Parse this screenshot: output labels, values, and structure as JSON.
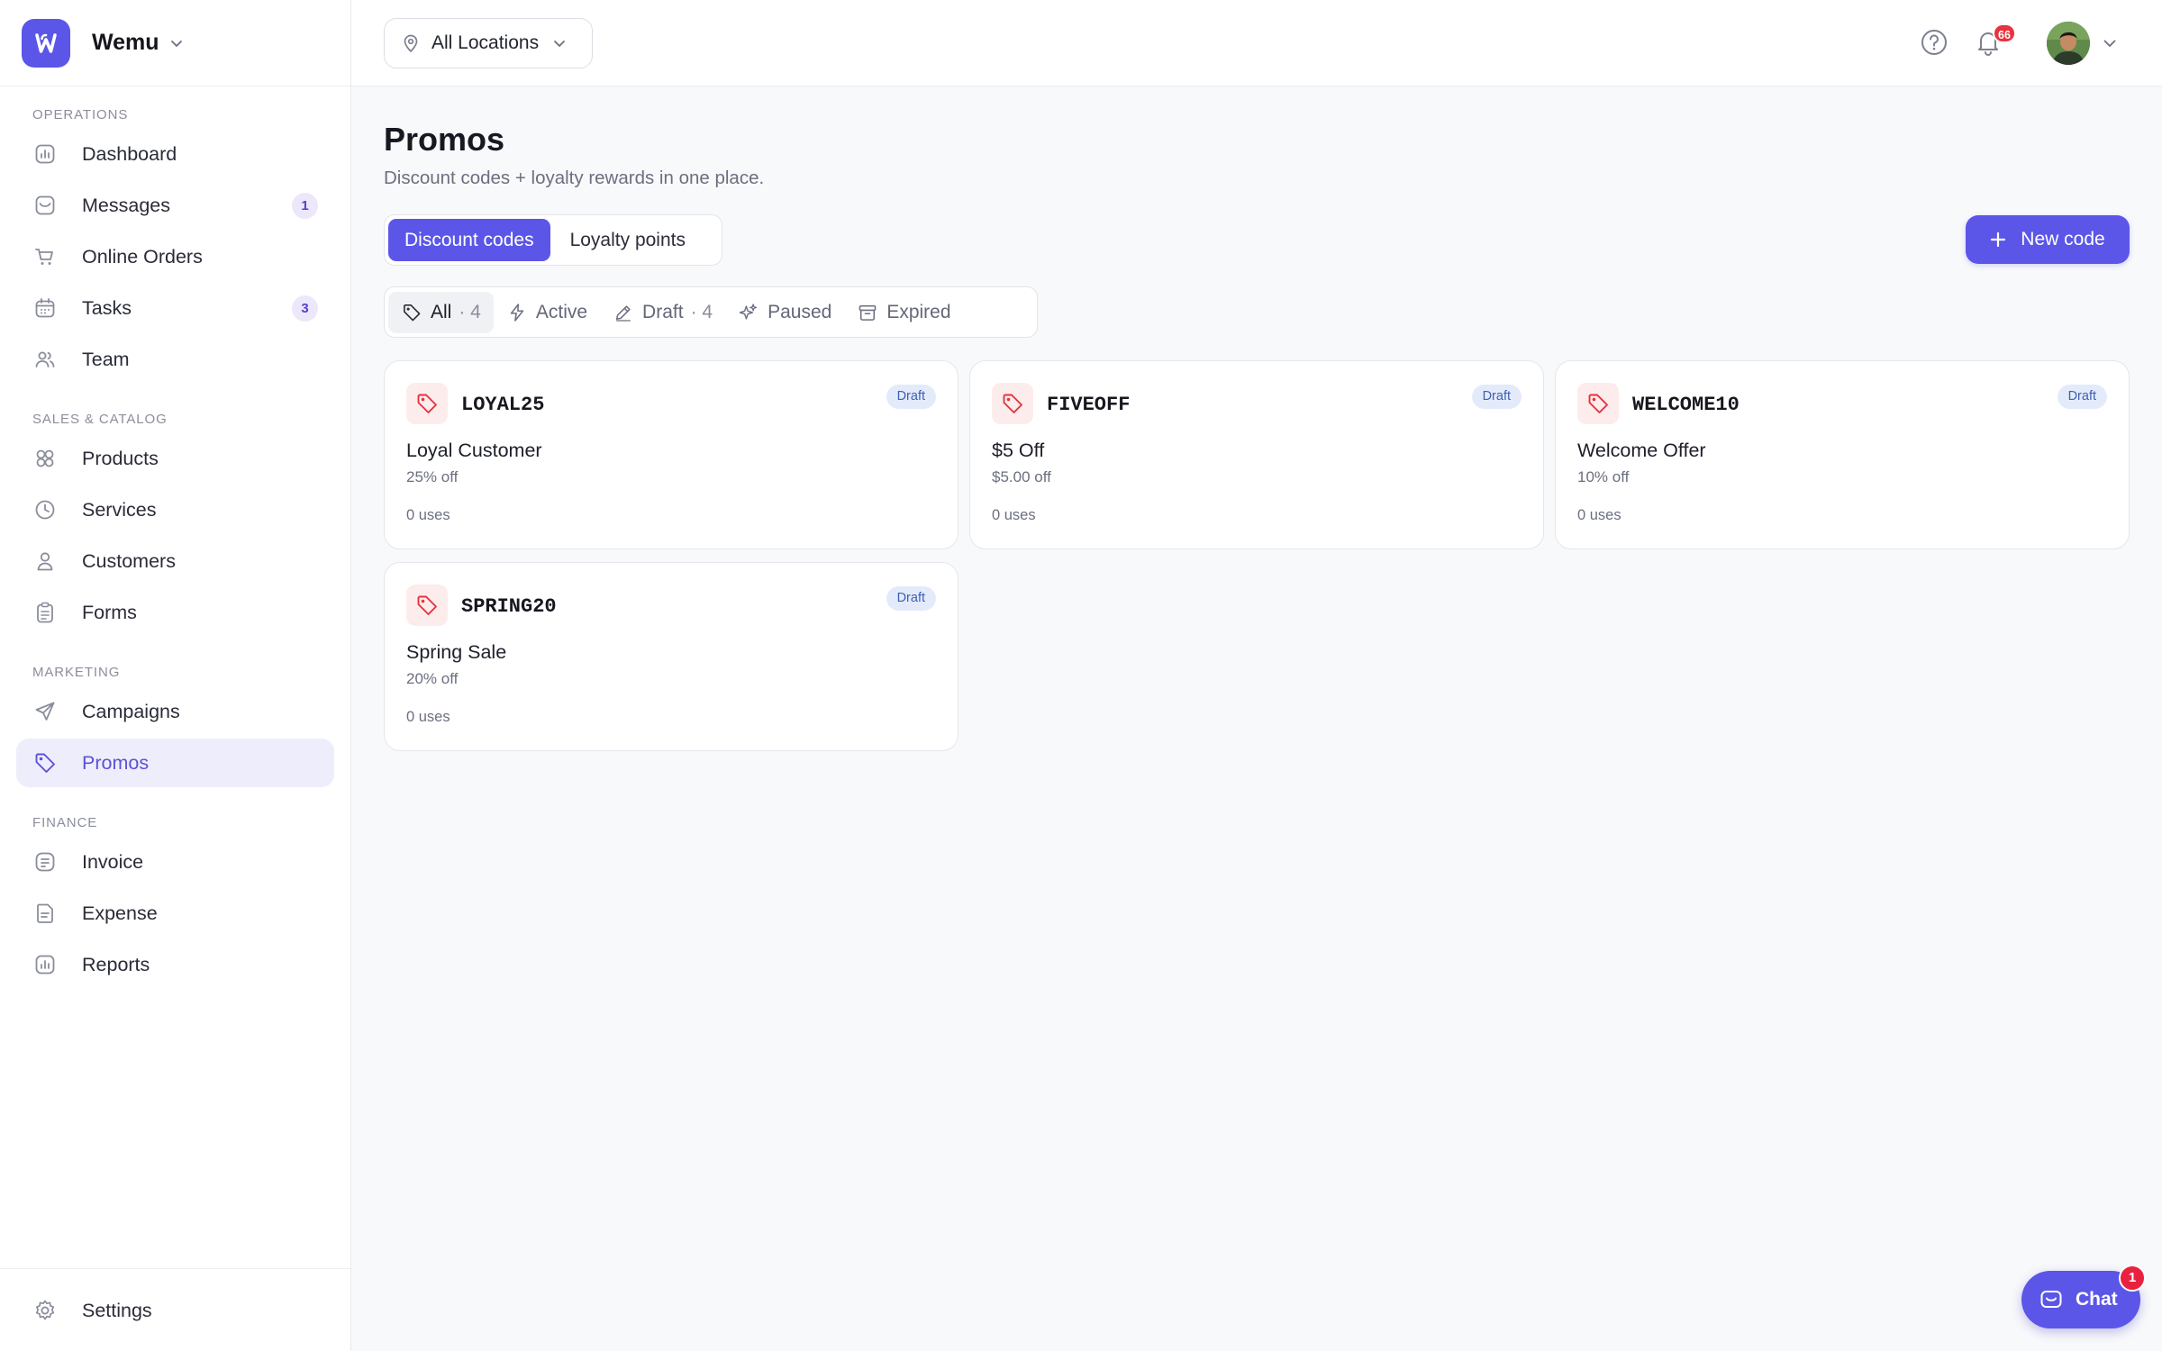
{
  "brand": {
    "name": "Wemu"
  },
  "sidebar": {
    "sections": [
      {
        "label": "OPERATIONS",
        "items": [
          {
            "label": "Dashboard",
            "icon": "chart-icon"
          },
          {
            "label": "Messages",
            "icon": "inbox-icon",
            "badge": "1"
          },
          {
            "label": "Online Orders",
            "icon": "cart-icon"
          },
          {
            "label": "Tasks",
            "icon": "calendar-icon",
            "badge": "3"
          },
          {
            "label": "Team",
            "icon": "team-icon"
          }
        ]
      },
      {
        "label": "SALES & CATALOG",
        "items": [
          {
            "label": "Products",
            "icon": "grid-icon"
          },
          {
            "label": "Services",
            "icon": "clock-icon"
          },
          {
            "label": "Customers",
            "icon": "user-icon"
          },
          {
            "label": "Forms",
            "icon": "clipboard-icon"
          }
        ]
      },
      {
        "label": "MARKETING",
        "items": [
          {
            "label": "Campaigns",
            "icon": "send-icon"
          },
          {
            "label": "Promos",
            "icon": "tag-icon",
            "active": true
          }
        ]
      },
      {
        "label": "FINANCE",
        "items": [
          {
            "label": "Invoice",
            "icon": "receipt-icon"
          },
          {
            "label": "Expense",
            "icon": "document-icon"
          },
          {
            "label": "Reports",
            "icon": "chart-icon"
          }
        ]
      }
    ],
    "settings_label": "Settings"
  },
  "topbar": {
    "location": "All Locations",
    "notification_count": "66"
  },
  "page": {
    "title": "Promos",
    "subtitle": "Discount codes + loyalty rewards in one place.",
    "tabs": [
      "Discount codes",
      "Loyalty points"
    ],
    "active_tab": 0,
    "new_button": "New code"
  },
  "filters": [
    {
      "label": "All",
      "count": "· 4",
      "icon": "tag-icon",
      "active": true
    },
    {
      "label": "Active",
      "count": "",
      "icon": "bolt-icon"
    },
    {
      "label": "Draft",
      "count": "· 4",
      "icon": "pencil-icon"
    },
    {
      "label": "Paused",
      "count": "",
      "icon": "sparkle-icon"
    },
    {
      "label": "Expired",
      "count": "",
      "icon": "archive-icon"
    }
  ],
  "promos": [
    {
      "code": "LOYAL25",
      "name": "Loyal Customer",
      "discount": "25% off",
      "uses": "0 uses",
      "status": "Draft"
    },
    {
      "code": "FIVEOFF",
      "name": "$5 Off",
      "discount": "$5.00 off",
      "uses": "0 uses",
      "status": "Draft"
    },
    {
      "code": "WELCOME10",
      "name": "Welcome Offer",
      "discount": "10% off",
      "uses": "0 uses",
      "status": "Draft"
    },
    {
      "code": "SPRING20",
      "name": "Spring Sale",
      "discount": "20% off",
      "uses": "0 uses",
      "status": "Draft"
    }
  ],
  "chat": {
    "label": "Chat",
    "badge": "1"
  },
  "colors": {
    "accent": "#5b56e8",
    "active_bg": "#eeedfb",
    "badge_red": "#e9323b",
    "draft_bg": "#e3ebfb"
  }
}
